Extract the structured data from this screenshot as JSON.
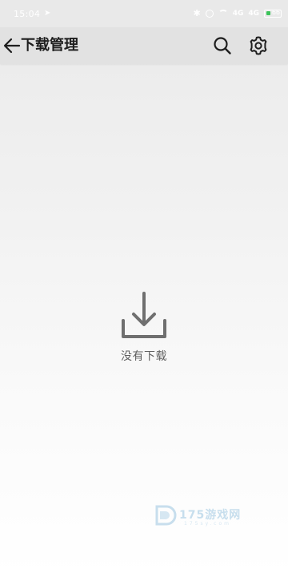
{
  "status_bar": {
    "time": "15:04",
    "time_icon": "navigation-icon",
    "network_label_1": "4G",
    "network_label_2": "4G",
    "battery_percent": "66",
    "battery_color": "#3cc35a"
  },
  "app_bar": {
    "title": "下载管理",
    "back_icon": "back-arrow-icon",
    "search_icon": "search-icon",
    "settings_icon": "settings-gear-icon"
  },
  "empty_state": {
    "icon": "download-tray-icon",
    "label": "没有下载"
  },
  "watermark": {
    "text": "175游戏网",
    "sub": "175sy.com"
  }
}
